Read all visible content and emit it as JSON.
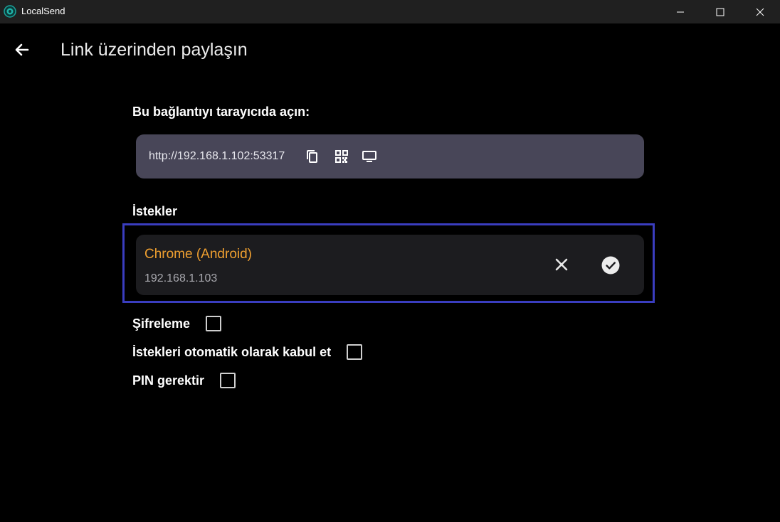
{
  "window": {
    "title": "LocalSend"
  },
  "header": {
    "title": "Link üzerinden paylaşın"
  },
  "link_section": {
    "label": "Bu bağlantıyı tarayıcıda açın:",
    "url": "http://192.168.1.102:53317",
    "icons": [
      "copy-icon",
      "qr-code-icon",
      "monitor-icon"
    ]
  },
  "requests_section": {
    "label": "İstekler",
    "items": [
      {
        "name": "Chrome (Android)",
        "ip": "192.168.1.103"
      }
    ]
  },
  "options": [
    {
      "label": "Şifreleme",
      "checked": false
    },
    {
      "label": "İstekleri otomatik olarak kabul et",
      "checked": false
    },
    {
      "label": "PIN gerektir",
      "checked": false
    }
  ],
  "colors": {
    "background": "#000000",
    "titlebar": "#202020",
    "link_box": "#484658",
    "request_card": "#1c1c1f",
    "accent_orange": "#f0a030",
    "highlight_border": "#3a3dbf"
  }
}
